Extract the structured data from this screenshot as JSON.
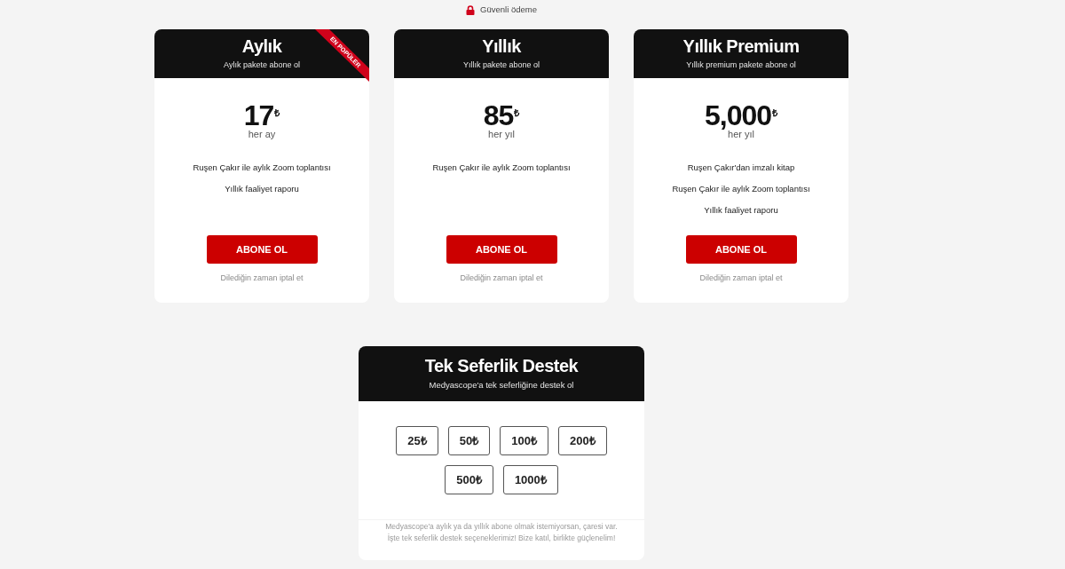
{
  "secure_notice": "Güvenli ödeme",
  "plans": [
    {
      "title": "Aylık",
      "subtitle": "Aylık pakete abone ol",
      "ribbon": "EN POPÜLER",
      "price": "17",
      "currency": "₺",
      "period": "her ay",
      "features": [
        "Ruşen Çakır ile aylık Zoom toplantısı",
        "Yıllık faaliyet raporu"
      ],
      "button": "ABONE OL",
      "cancel_note": "Dilediğin zaman iptal et"
    },
    {
      "title": "Yıllık",
      "subtitle": "Yıllık pakete abone ol",
      "price": "85",
      "currency": "₺",
      "period": "her yıl",
      "features": [
        "Ruşen Çakır ile aylık Zoom toplantısı"
      ],
      "button": "ABONE OL",
      "cancel_note": "Dilediğin zaman iptal et"
    },
    {
      "title": "Yıllık Premium",
      "subtitle": "Yıllık premium pakete abone ol",
      "price": "5,000",
      "currency": "₺",
      "period": "her yıl",
      "features": [
        "Ruşen Çakır'dan imzalı kitap",
        "Ruşen Çakır ile aylık Zoom toplantısı",
        "Yıllık faaliyet raporu"
      ],
      "button": "ABONE OL",
      "cancel_note": "Dilediğin zaman iptal et"
    }
  ],
  "one_time_support": {
    "title": "Tek Seferlik Destek",
    "subtitle": "Medyascope'a tek seferliğine destek ol",
    "amounts": [
      "25₺",
      "50₺",
      "100₺",
      "200₺",
      "500₺",
      "1000₺"
    ],
    "note_lines": [
      "Medyascope'a aylık ya da yıllık abone olmak istemiyorsan, çaresi var.",
      "İşte tek seferlik destek seçeneklerimiz! Bize katıl, birlikte güçlenelim!"
    ]
  }
}
